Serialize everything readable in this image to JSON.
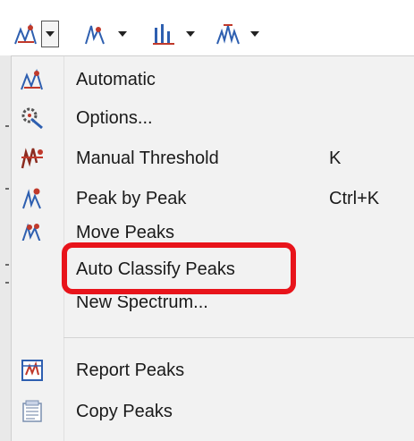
{
  "toolbar": {
    "buttons": [
      {
        "icon": "automatic-peaks-icon"
      },
      {
        "icon": "peak-pick-icon"
      },
      {
        "icon": "bar-peaks-icon"
      },
      {
        "icon": "multiplet-icon"
      }
    ]
  },
  "menu": {
    "items": [
      {
        "label": "Automatic",
        "shortcut": "",
        "icon": "automatic-icon"
      },
      {
        "label": "Options...",
        "shortcut": "",
        "icon": "options-icon"
      },
      {
        "label": "Manual Threshold",
        "shortcut": "K",
        "icon": "manual-threshold-icon"
      },
      {
        "label": "Peak by Peak",
        "shortcut": "Ctrl+K",
        "icon": "peak-by-peak-icon"
      },
      {
        "label": "Move Peaks",
        "shortcut": "",
        "icon": "move-peaks-icon"
      },
      {
        "label": "Auto Classify Peaks",
        "shortcut": "",
        "icon": ""
      },
      {
        "label": "New Spectrum...",
        "shortcut": "",
        "icon": ""
      },
      {
        "label": "Report Peaks",
        "shortcut": "",
        "icon": "report-peaks-icon"
      },
      {
        "label": "Copy Peaks",
        "shortcut": "",
        "icon": "copy-peaks-icon"
      }
    ]
  },
  "colors": {
    "highlight_border": "#e8141b",
    "menu_background": "#f2f2f2",
    "icon_red": "#c0392b",
    "icon_blue": "#2e5fb0"
  }
}
